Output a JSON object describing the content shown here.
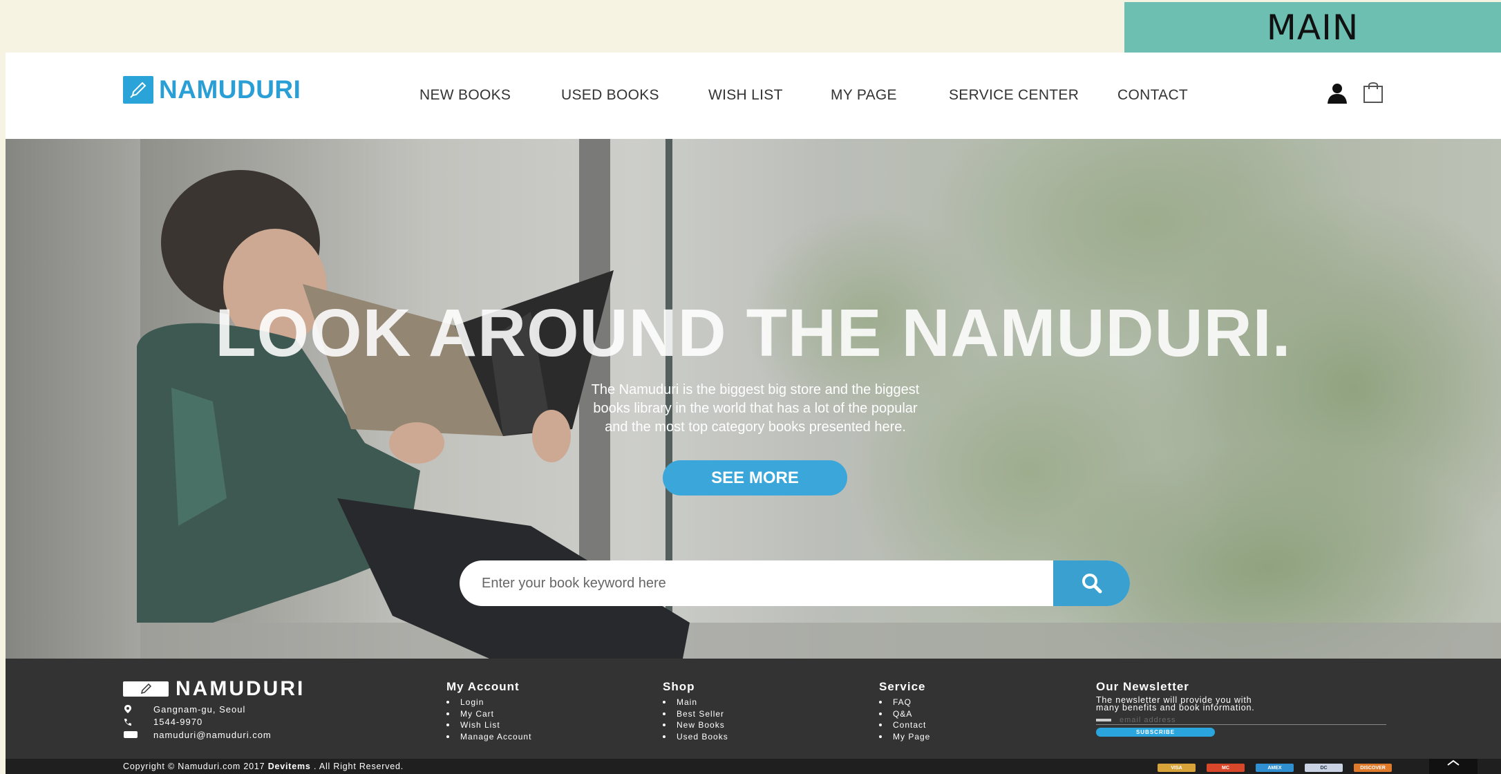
{
  "page_tag": "MAIN",
  "header": {
    "logo_text": "NAMUDURI",
    "nav": [
      {
        "label": "NEW BOOKS"
      },
      {
        "label": "USED BOOKS"
      },
      {
        "label": "WISH LIST"
      },
      {
        "label": "MY PAGE"
      },
      {
        "label": "SERVICE CENTER"
      },
      {
        "label": "CONTACT"
      }
    ],
    "icons": [
      "user-icon",
      "shopping-bag-icon"
    ]
  },
  "hero": {
    "title": "LOOK AROUND THE NAMUDURI.",
    "description": [
      "The Namuduri is the biggest big store and the biggest",
      "books library in the world that has a lot of the popular",
      "and the most top category books presented here."
    ],
    "button_label": "SEE MORE",
    "search_placeholder": "Enter your book keyword here",
    "search_icon": "search-icon"
  },
  "footer": {
    "logo_text": "NAMUDURI",
    "contact": {
      "address": "Gangnam-gu, Seoul",
      "phone": "1544-9970",
      "email": "namuduri@namuduri.com"
    },
    "columns": [
      {
        "title": "My Account",
        "items": [
          "Login",
          "My Cart",
          "Wish List",
          "Manage Account"
        ]
      },
      {
        "title": "Shop",
        "items": [
          "Main",
          "Best Seller",
          "New Books",
          "Used Books"
        ]
      },
      {
        "title": "Service",
        "items": [
          "FAQ",
          "Q&A",
          "Contact",
          "My Page"
        ]
      }
    ],
    "newsletter": {
      "title": "Our Newsletter",
      "text_line1": "The newsletter will provide you with",
      "text_line2": "many benefits and book information.",
      "email_placeholder": "email address",
      "button_label": "SUBSCRIBE"
    },
    "copyright_prefix": "Copyright © Namuduri.com 2017",
    "copyright_brand": "Devitems",
    "copyright_suffix": ". All Right Reserved.",
    "payments": [
      {
        "name": "VISA",
        "color": "#d8a43a"
      },
      {
        "name": "MC",
        "color": "#d9472b"
      },
      {
        "name": "AMEX",
        "color": "#2f8fd1"
      },
      {
        "name": "DC",
        "color": "#c9d3e3"
      },
      {
        "name": "DISCOVER",
        "color": "#e07a2b"
      }
    ]
  },
  "colors": {
    "accent": "#3aa6d9",
    "page_tag_bg": "#6cbfb1",
    "footer_bg": "#333333",
    "page_bg": "#f6f3e2"
  }
}
